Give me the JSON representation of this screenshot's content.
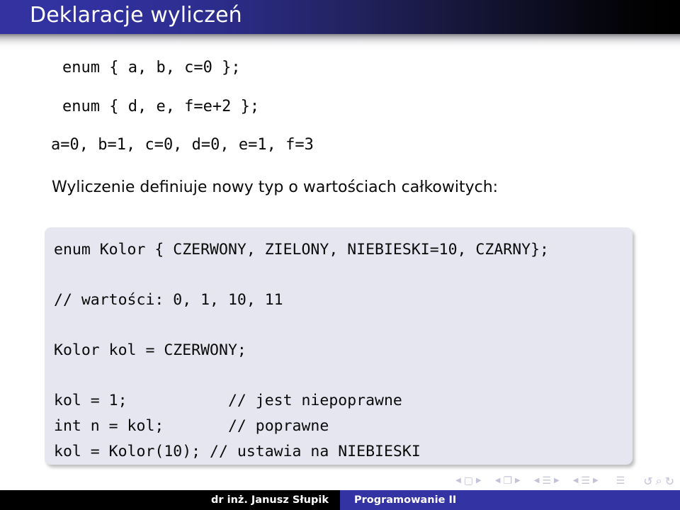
{
  "slide": {
    "title": "Deklaracje wyliczeń",
    "title_bar_color_left": "#3332a0",
    "title_bar_color_right": "#000000"
  },
  "content": {
    "enum_line_1": "enum { a, b, c=0 };",
    "enum_line_2": "enum { d, e, f=e+2 };",
    "values_line": "a=0, b=1, c=0, d=0, e=1, f=3",
    "prose_line": "Wyliczenie definiuje nowy typ o wartościach całkowitych:"
  },
  "code_block": {
    "background_color": "#e6e6f0",
    "lines": [
      "enum Kolor { CZERWONY, ZIELONY, NIEBIESKI=10, CZARNY};",
      "// wartości: 0, 1, 10, 11",
      "Kolor kol = CZERWONY;",
      "kol = 1;           // jest niepoprawne",
      "int n = kol;       // poprawne",
      "kol = Kolor(10); // ustawia na NIEBIESKI"
    ]
  },
  "navigation": {
    "groups": [
      {
        "name": "frame-nav",
        "prev": "◀",
        "glyph": "▢",
        "next": "▶"
      },
      {
        "name": "subsection-nav",
        "prev": "◀",
        "glyph": "❐",
        "next": "▶"
      },
      {
        "name": "section-nav",
        "prev": "◀",
        "glyph": "☰",
        "next": "▶"
      },
      {
        "name": "document-nav",
        "prev": "◀",
        "glyph": "☰",
        "next": "▶"
      }
    ],
    "toc_glyph": "☰",
    "back_glyph": "↺",
    "search_glyph": "⌕",
    "forward_glyph": "↻"
  },
  "footer": {
    "author": "dr inż. Janusz Słupik",
    "course": "Programowanie II",
    "left_color": "#000000",
    "right_color": "#3433a3"
  }
}
